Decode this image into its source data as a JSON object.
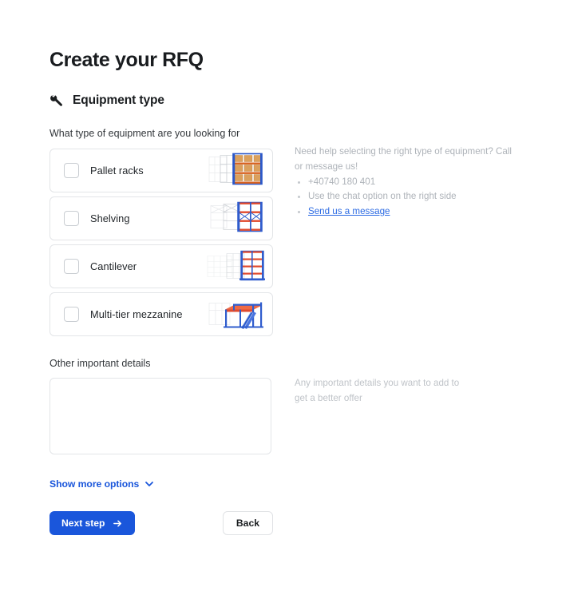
{
  "page": {
    "title": "Create your RFQ"
  },
  "section": {
    "icon": "wrench-icon",
    "title": "Equipment type"
  },
  "equipment": {
    "label": "What type of equipment are you looking for",
    "options": [
      {
        "label": "Pallet racks",
        "checked": false,
        "thumbnail": "pallet-racks-thumbnail"
      },
      {
        "label": "Shelving",
        "checked": false,
        "thumbnail": "shelving-thumbnail"
      },
      {
        "label": "Cantilever",
        "checked": false,
        "thumbnail": "cantilever-thumbnail"
      },
      {
        "label": "Multi-tier mezzanine",
        "checked": false,
        "thumbnail": "multi-tier-mezzanine-thumbnail"
      }
    ]
  },
  "help": {
    "intro": "Need help selecting the right type of equipment? Call or message us!",
    "items": [
      "+40740 180 401",
      "Use the chat option on the right side"
    ],
    "link_label": "Send us a message"
  },
  "details": {
    "label": "Other important details",
    "value": "",
    "placeholder": "",
    "hint": "Any important details you want to add to get a better offer"
  },
  "show_more": {
    "label": "Show more options",
    "icon": "chevron-down-icon"
  },
  "actions": {
    "next_label": "Next step",
    "next_icon": "arrow-right-icon",
    "back_label": "Back"
  },
  "colors": {
    "accent_blue": "#1a56db",
    "link_blue": "#2b6ae3",
    "border_gray": "#e3e5e8",
    "muted_text": "#aeb3b9",
    "background": "#ffffff"
  }
}
